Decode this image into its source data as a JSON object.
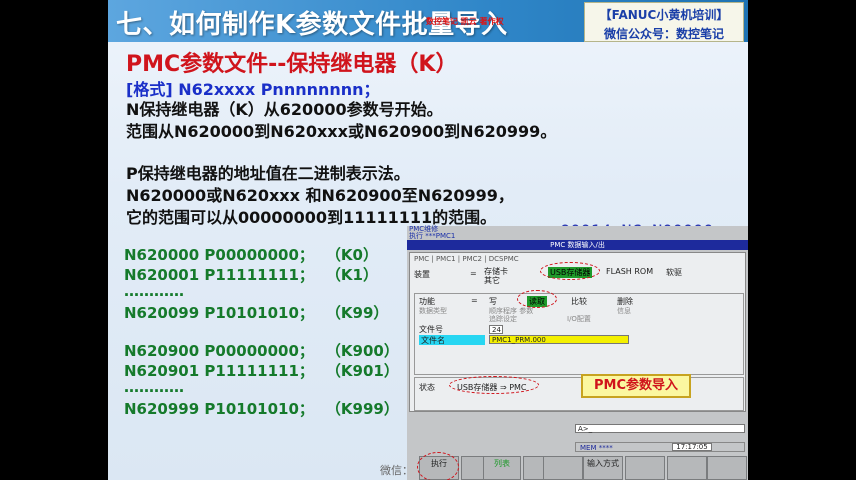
{
  "slide": {
    "title": "七、如何制作K参数文件批量导入",
    "title_overlay": "数控笔记 凯云 著作权",
    "brand_line1": "【FANUC小黄机培训】",
    "brand_line2": "微信公众号：数控笔记",
    "heading": "PMC参数文件--保持继电器（K）",
    "format": "[格式] N62xxxx Pnnnnnnnn；",
    "lines": [
      "N保持继电器（K）从620000参数号开始。",
      "范围从N620000到N620xxx或N620900到N620999。",
      "P保持继电器的地址值在二进制表示法。",
      " N620000或N620xxx 和N620900至N620999，",
      "它的范围可以从00000000到11111111的范围。"
    ],
    "k_rows": [
      {
        "n": "N620000",
        "p": "P00000000；",
        "k": "（K0）"
      },
      {
        "n": "N620001",
        "p": "P11111111；",
        "k": "（K1）"
      },
      {
        "n": "N620099",
        "p": "P10101010；",
        "k": "（K99）"
      },
      {
        "n": "N620900",
        "p": "P00000000；",
        "k": "（K900）"
      },
      {
        "n": "N620901",
        "p": "P11111111；",
        "k": "（K901）"
      },
      {
        "n": "N620999",
        "p": "P10101010；",
        "k": "（K999）"
      }
    ],
    "dots": "…………",
    "nc_label": "O0014.NC N00000",
    "weixin": "微信："
  },
  "cnc": {
    "top_small1": "PMC维修",
    "top_small2": "执行 ***PMC1",
    "header": "PMC 数据输入/出",
    "tabs": "PMC   |  PMC1  |  PMC2  |  DCSPMC",
    "device_label": "装置",
    "device_opt1": "存储卡",
    "device_opt2": "其它",
    "device_selected": "USB存储器",
    "device_opt3": "FLASH ROM",
    "device_opt4": "软驱",
    "func_label": "功能",
    "func_write": "写",
    "func_read": "读取",
    "func_compare": "比较",
    "func_delete": "删除",
    "data_type_label": "数据类型",
    "data_type_opts": "顺序程序         参数",
    "trace_label": "追踪设定",
    "io_label": "I/O配置",
    "info_label": "信息",
    "file_no_label": "文件号",
    "file_no_value": "24",
    "file_name_label": "文件名",
    "file_name_value": "PMC1_PRM.000",
    "state_label": "状态",
    "state_value": "USB存储器 ⇒ PMC",
    "pmc_import": "PMC参数导入",
    "cmd_prompt": "A>_",
    "mem": "MEM  ****",
    "clock": "17:17:05",
    "softkeys": [
      "执行",
      "",
      "列表",
      "",
      "",
      "输入方式",
      "",
      "",
      ""
    ]
  },
  "colors": {
    "accent_red": "#d0141c",
    "accent_blue": "#1a2fc8",
    "k_green": "#157a2b",
    "title_blue": "#2f86c8"
  }
}
